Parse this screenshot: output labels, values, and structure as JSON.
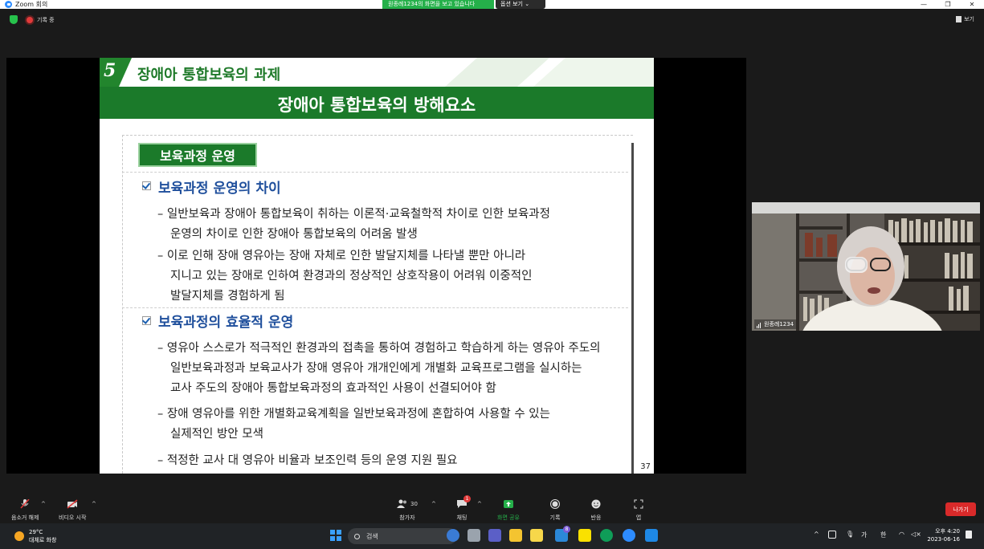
{
  "window": {
    "title": "Zoom 회의",
    "controls": [
      "—",
      "❐",
      "✕"
    ]
  },
  "share_banner": {
    "message": "원종례1234의 화면을 보고 있습니다",
    "options": "옵션 보기 ⌄"
  },
  "meeting_bar": {
    "recording": "기록 중",
    "view": "보기"
  },
  "slide": {
    "section_number": "5",
    "section_title": "장애아 통합보육의 과제",
    "main_title": "장애아 통합보육의 방해요소",
    "badge": "보육과정 운영",
    "heading1": "보육과정 운영의 차이",
    "h1_lines": [
      "– 일반보육과 장애아 통합보육이 취하는 이론적·교육철학적 차이로 인한 보육과정",
      "운영의 차이로 인한 장애아 통합보육의 어려움 발생",
      "– 이로 인해 장애 영유아는 장애 자체로 인한 발달지체를 나타낼 뿐만 아니라",
      "지니고 있는 장애로 인하여 환경과의 정상적인 상호작용이 어려워 이중적인",
      "발달지체를 경험하게 됨"
    ],
    "heading2": "보육과정의 효율적 운영",
    "h2_lines": [
      "– 영유아 스스로가 적극적인 환경과의 접촉을 통하여 경험하고 학습하게 하는 영유아 주도의",
      "일반보육과정과 보육교사가 장애 영유아 개개인에게 개별화 교육프로그램을 실시하는",
      "교사 주도의 장애아 통합보육과정의 효과적인 사용이 선결되어야 함",
      "– 장애 영유아를 위한 개별화교육계획을 일반보육과정에 혼합하여 사용할 수 있는",
      "실제적인 방안 모색",
      "– 적정한 교사 대 영유아 비율과 보조인력 등의 운영 지원 필요"
    ],
    "page_number": "37"
  },
  "webcam": {
    "name": "원종례1234"
  },
  "toolbar": {
    "unmute": "음소거 해제",
    "video": "비디오 시작",
    "participants": "참가자",
    "participants_count": "30",
    "chat": "채팅",
    "chat_badge": "1",
    "share": "화면 공유",
    "record": "기록",
    "reactions": "반응",
    "apps": "앱",
    "leave": "나가기"
  },
  "taskbar": {
    "temperature": "29°C",
    "weather_text": "대체로 화창",
    "search": "검색",
    "tray_ime1": "가",
    "tray_ime2": "한",
    "time": "오후 4:20",
    "date": "2023-06-16",
    "notif_badge": "8"
  },
  "colors": {
    "slide_green": "#1b7a2a",
    "heading_blue": "#1f4f9c",
    "leave_red": "#d92a2a",
    "banner_green": "#25b04a"
  }
}
